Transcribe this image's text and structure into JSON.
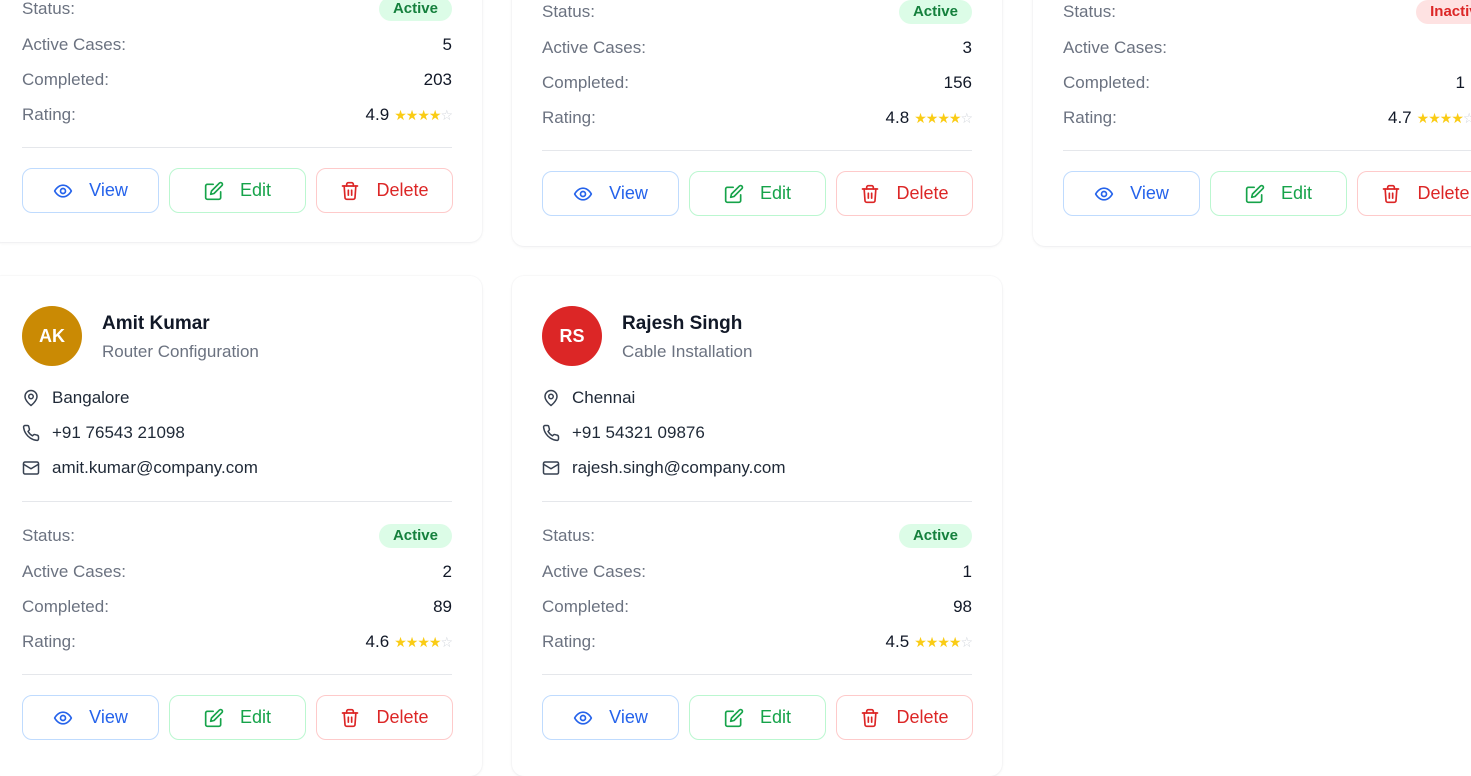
{
  "labels": {
    "status": "Status:",
    "active_cases": "Active Cases:",
    "completed": "Completed:",
    "rating": "Rating:",
    "view": "View",
    "edit": "Edit",
    "delete": "Delete"
  },
  "colors": {
    "view": "#2563eb",
    "edit": "#16a34a",
    "delete": "#dc2626",
    "badge_active_bg": "#dcfce7",
    "badge_active_text": "#15803d",
    "badge_inactive_bg": "#fee2e2",
    "badge_inactive_text": "#dc2626",
    "star": "#facc15"
  },
  "icons": [
    "map-pin-icon",
    "phone-icon",
    "mail-icon",
    "eye-icon",
    "edit-icon",
    "trash-icon",
    "star-icon"
  ],
  "technicians": [
    {
      "status": "Active",
      "active_cases": "5",
      "completed": "203",
      "rating": "4.9",
      "stars_filled": 4,
      "stars_total": 5
    },
    {
      "status": "Active",
      "active_cases": "3",
      "completed": "156",
      "rating": "4.8",
      "stars_filled": 4,
      "stars_total": 5
    },
    {
      "status": "Inactive",
      "active_cases": "",
      "completed": "1",
      "rating": "4.7",
      "stars_filled": 4,
      "stars_total": 5
    },
    {
      "initials": "AK",
      "avatar_color": "#ca8a04",
      "name": "Amit Kumar",
      "specialization": "Router Configuration",
      "location": "Bangalore",
      "phone": "+91 76543 21098",
      "email": "amit.kumar@company.com",
      "status": "Active",
      "active_cases": "2",
      "completed": "89",
      "rating": "4.6",
      "stars_filled": 4,
      "stars_total": 5
    },
    {
      "initials": "RS",
      "avatar_color": "#dc2626",
      "name": "Rajesh Singh",
      "specialization": "Cable Installation",
      "location": "Chennai",
      "phone": "+91 54321 09876",
      "email": "rajesh.singh@company.com",
      "status": "Active",
      "active_cases": "1",
      "completed": "98",
      "rating": "4.5",
      "stars_filled": 4,
      "stars_total": 5
    }
  ]
}
